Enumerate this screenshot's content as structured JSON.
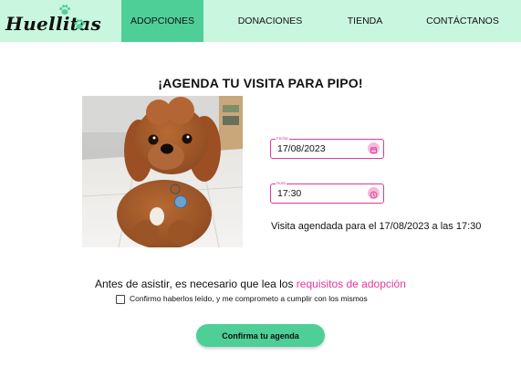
{
  "brand": {
    "name": "Huellitas"
  },
  "nav": {
    "items": [
      {
        "label": "ADOPCIONES",
        "active": true
      },
      {
        "label": "DONACIONES",
        "active": false
      },
      {
        "label": "TIENDA",
        "active": false
      },
      {
        "label": "CONTÁCTANOS",
        "active": false
      }
    ]
  },
  "page": {
    "title": "¡AGENDA TU VISITA PARA PIPO!"
  },
  "form": {
    "date": {
      "label": "Fecha",
      "value": "17/08/2023",
      "icon": "calendar-icon"
    },
    "time": {
      "label": "Hora",
      "value": "17:30",
      "icon": "clock-icon"
    },
    "confirmation": "Visita agendada para el 17/08/2023 a las 17:30"
  },
  "requirements": {
    "text": "Antes de asistir, es necesario que lea los ",
    "link": "requisitos de adopción",
    "checkbox_label": "Confirmo haberlos leído, y me comprometo a cumplir con los mismos",
    "checked": false
  },
  "submit": {
    "label": "Confirma tu agenda"
  },
  "colors": {
    "nav_bg": "#c9f6df",
    "accent_green": "#4fcf98",
    "accent_pink": "#e2389a"
  }
}
